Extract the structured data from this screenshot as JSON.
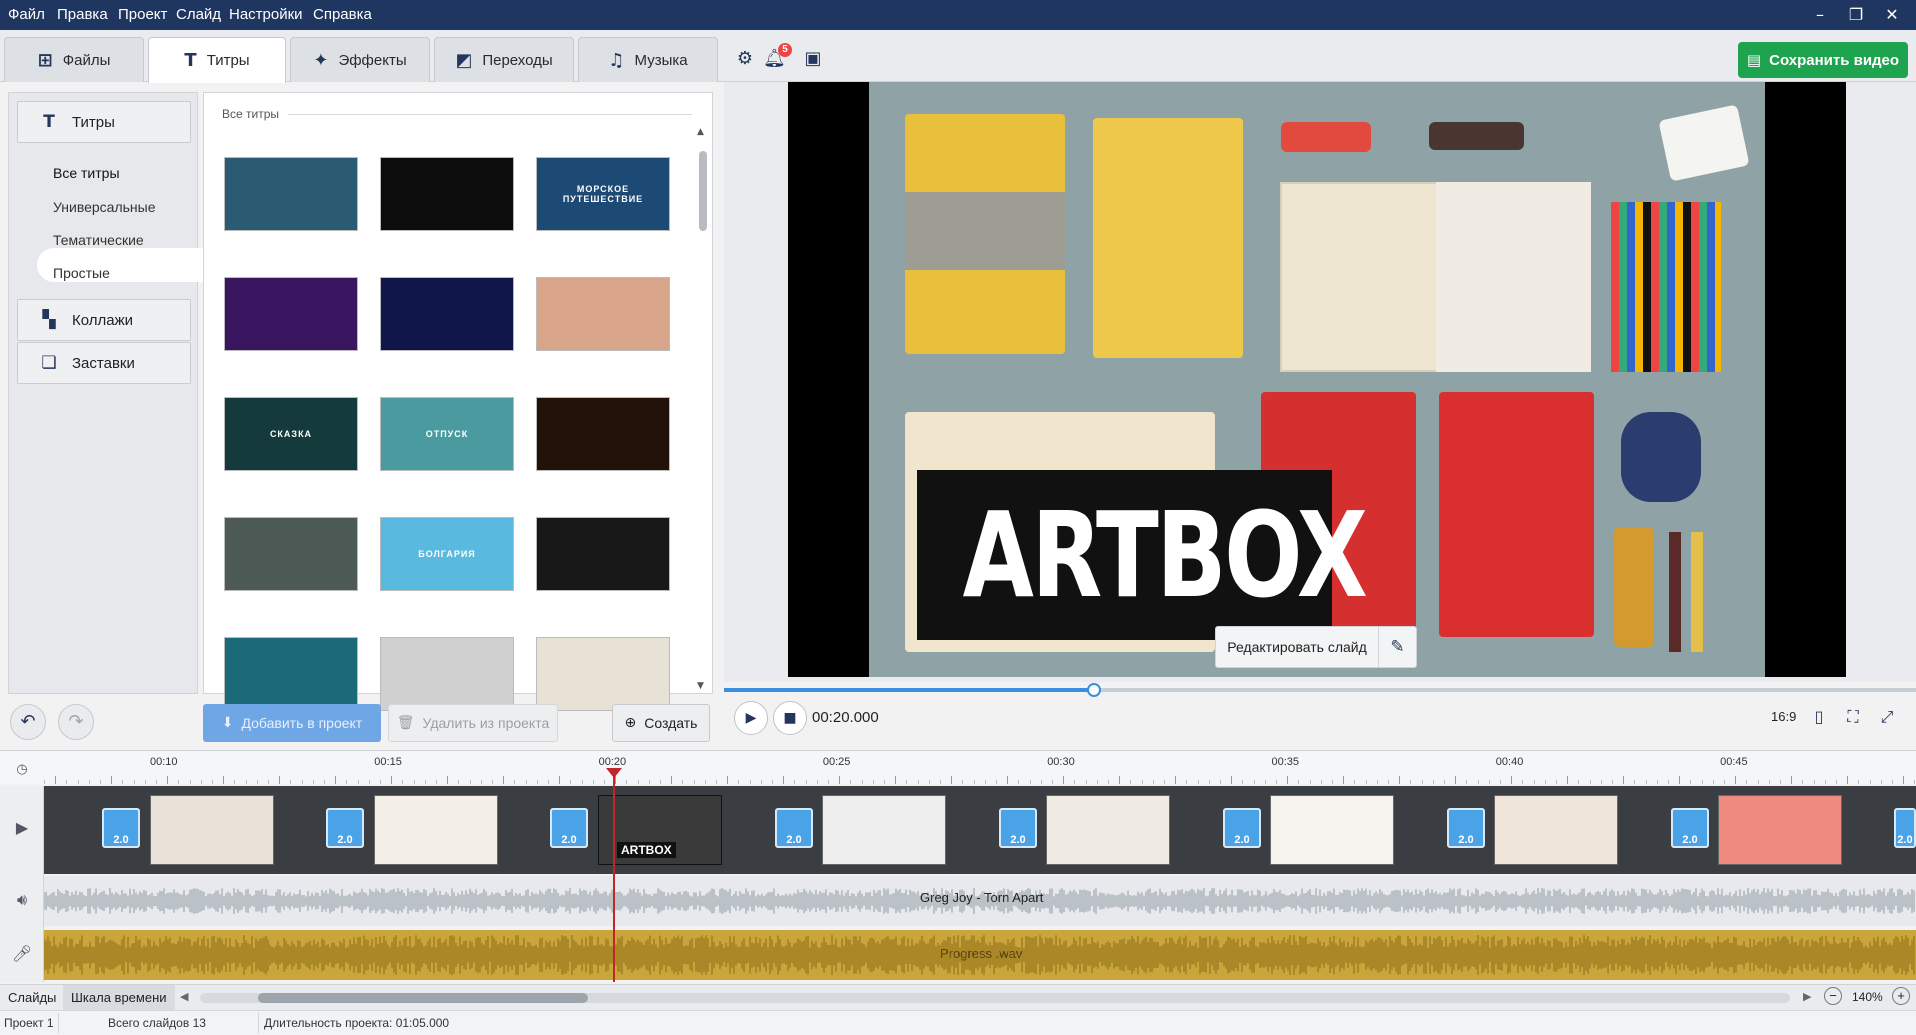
{
  "menu": {
    "items": [
      "Файл",
      "Правка",
      "Проект",
      "Слайд",
      "Настройки",
      "Справка"
    ]
  },
  "tabs": [
    {
      "label": "Файлы",
      "icon": "add-file-icon"
    },
    {
      "label": "Титры",
      "icon": "text-t-icon"
    },
    {
      "label": "Эффекты",
      "icon": "star-effects-icon"
    },
    {
      "label": "Переходы",
      "icon": "transition-icon"
    },
    {
      "label": "Музыка",
      "icon": "music-note-icon"
    }
  ],
  "notifications": {
    "count": "5"
  },
  "save_button": {
    "label": "Сохранить видео"
  },
  "left_panel": {
    "categories": [
      {
        "label": "Титры",
        "icon": "text-t-icon"
      },
      {
        "label": "Коллажи",
        "icon": "collage-icon"
      },
      {
        "label": "Заставки",
        "icon": "intro-icon"
      }
    ],
    "subcategories": [
      "Все титры",
      "Универсальные",
      "Тематические",
      "Простые"
    ]
  },
  "gallery": {
    "title": "Все титры",
    "thumbs": [
      {
        "text": "",
        "bg": "#2a5b73"
      },
      {
        "text": "",
        "bg": "#0c0c0c"
      },
      {
        "text": "МОРСКОЕ ПУТЕШЕСТВИЕ",
        "bg": "#1d4a74"
      },
      {
        "text": "",
        "bg": "#3a1560"
      },
      {
        "text": "",
        "bg": "#10154a"
      },
      {
        "text": "",
        "bg": "#d8a58a"
      },
      {
        "text": "СКАЗКА",
        "bg": "#153a3c"
      },
      {
        "text": "ОТПУСК",
        "bg": "#4a9ba0"
      },
      {
        "text": "",
        "bg": "#231209"
      },
      {
        "text": "",
        "bg": "#4d5a55"
      },
      {
        "text": "БОЛГАРИЯ",
        "bg": "#5ab9de"
      },
      {
        "text": "",
        "bg": "#181818"
      },
      {
        "text": "",
        "bg": "#1a6a7a"
      },
      {
        "text": "",
        "bg": "#d0d0d0"
      },
      {
        "text": "",
        "bg": "#e8e2d6"
      }
    ]
  },
  "actions": {
    "add": "Добавить в проект",
    "delete": "Удалить из проекта",
    "create": "Создать"
  },
  "preview": {
    "title_text": "ARTBOX",
    "edit_slide": "Редактировать слайд",
    "timecode": "00:20.000",
    "aspect": "16:9",
    "progress": 0.31
  },
  "timeline": {
    "ruler_labels": [
      "00:10",
      "00:15",
      "00:20",
      "00:25",
      "00:30",
      "00:35",
      "00:40",
      "00:45"
    ],
    "transition_duration": "2.0",
    "audio_tracks": [
      "Greg Joy - Torn Apart",
      "Progress .wav"
    ]
  },
  "bottom_tabs": [
    "Слайды",
    "Шкала времени"
  ],
  "zoom": "140%",
  "status": {
    "project": "Проект 1",
    "slides_total": "Всего слайдов 13",
    "duration": "Длительность проекта: 01:05.000"
  }
}
